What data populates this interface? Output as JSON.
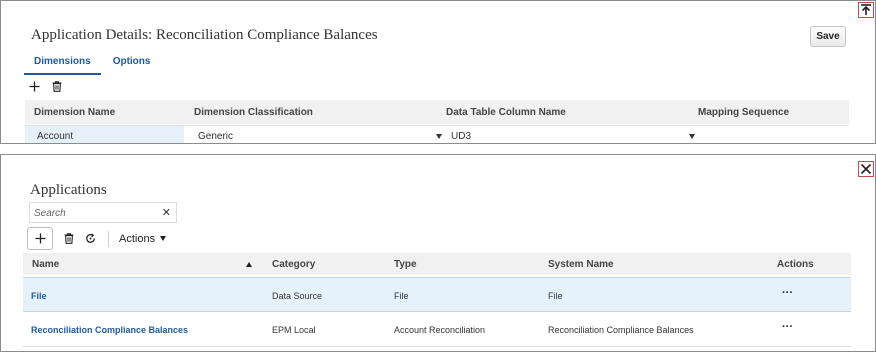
{
  "details": {
    "title": "Application Details: Reconciliation Compliance Balances",
    "save_label": "Save",
    "tabs": [
      {
        "label": "Dimensions",
        "active": true
      },
      {
        "label": "Options",
        "active": false
      }
    ],
    "toolbar": {
      "add_icon": "plus-icon",
      "delete_icon": "trash-icon"
    },
    "columns": [
      "Dimension Name",
      "Dimension Classification",
      "Data Table Column Name",
      "Mapping Sequence"
    ],
    "rows": [
      {
        "name": "Account",
        "classification": "Generic",
        "column": "UD3",
        "mapping_sequence": ""
      }
    ],
    "corner_icon": "collapse-up-icon"
  },
  "applications": {
    "title": "Applications",
    "search": {
      "placeholder": "Search",
      "value": ""
    },
    "toolbar": {
      "add_icon": "plus-icon",
      "delete_icon": "trash-icon",
      "refresh_icon": "refresh-icon",
      "actions_label": "Actions"
    },
    "columns": [
      "Name",
      "Category",
      "Type",
      "System Name",
      "Actions"
    ],
    "sort": {
      "column": "Name",
      "direction": "ascending"
    },
    "rows": [
      {
        "name": "File",
        "category": "Data Source",
        "type": "File",
        "system_name": "File",
        "actions": "···",
        "selected": true
      },
      {
        "name": "Reconciliation Compliance Balances",
        "category": "EPM Local",
        "type": "Account Reconciliation",
        "system_name": "Reconciliation Compliance Balances",
        "actions": "···",
        "selected": false
      }
    ],
    "corner_icon": "close-icon"
  },
  "colors": {
    "link": "#1f5b9c",
    "selected_row": "#e6f2fb",
    "header_bg": "#f1f1f1",
    "corner_border": "#c0504d"
  }
}
